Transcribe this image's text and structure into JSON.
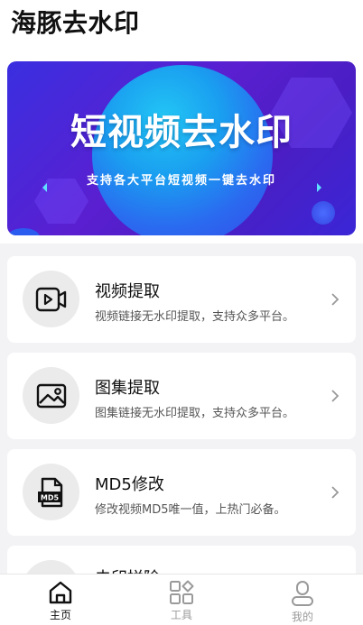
{
  "app": {
    "title": "海豚去水印"
  },
  "banner": {
    "title": "短视频去水印",
    "subtitle": "支持各大平台短视频一键去水印"
  },
  "cards": [
    {
      "title": "视频提取",
      "desc": "视频链接无水印提取，支持众多平台。",
      "icon": "video-icon"
    },
    {
      "title": "图集提取",
      "desc": "图集链接无水印提取，支持众多平台。",
      "icon": "image-icon"
    },
    {
      "title": "MD5修改",
      "desc": "修改视频MD5唯一值，上热门必备。",
      "icon": "md5-file-icon"
    },
    {
      "title": "去印拼除",
      "icon": "tool-icon"
    }
  ],
  "tabbar": {
    "items": [
      {
        "label": "主页",
        "icon": "home-icon",
        "active": true
      },
      {
        "label": "工具",
        "icon": "grid-icon",
        "active": false
      },
      {
        "label": "我的",
        "icon": "user-icon",
        "active": false
      }
    ]
  },
  "colors": {
    "banner_start": "#3a2fe0",
    "banner_circle": "#1a9ef0",
    "page_bg": "#f3f3f5",
    "icon_bg": "#ebebeb"
  }
}
